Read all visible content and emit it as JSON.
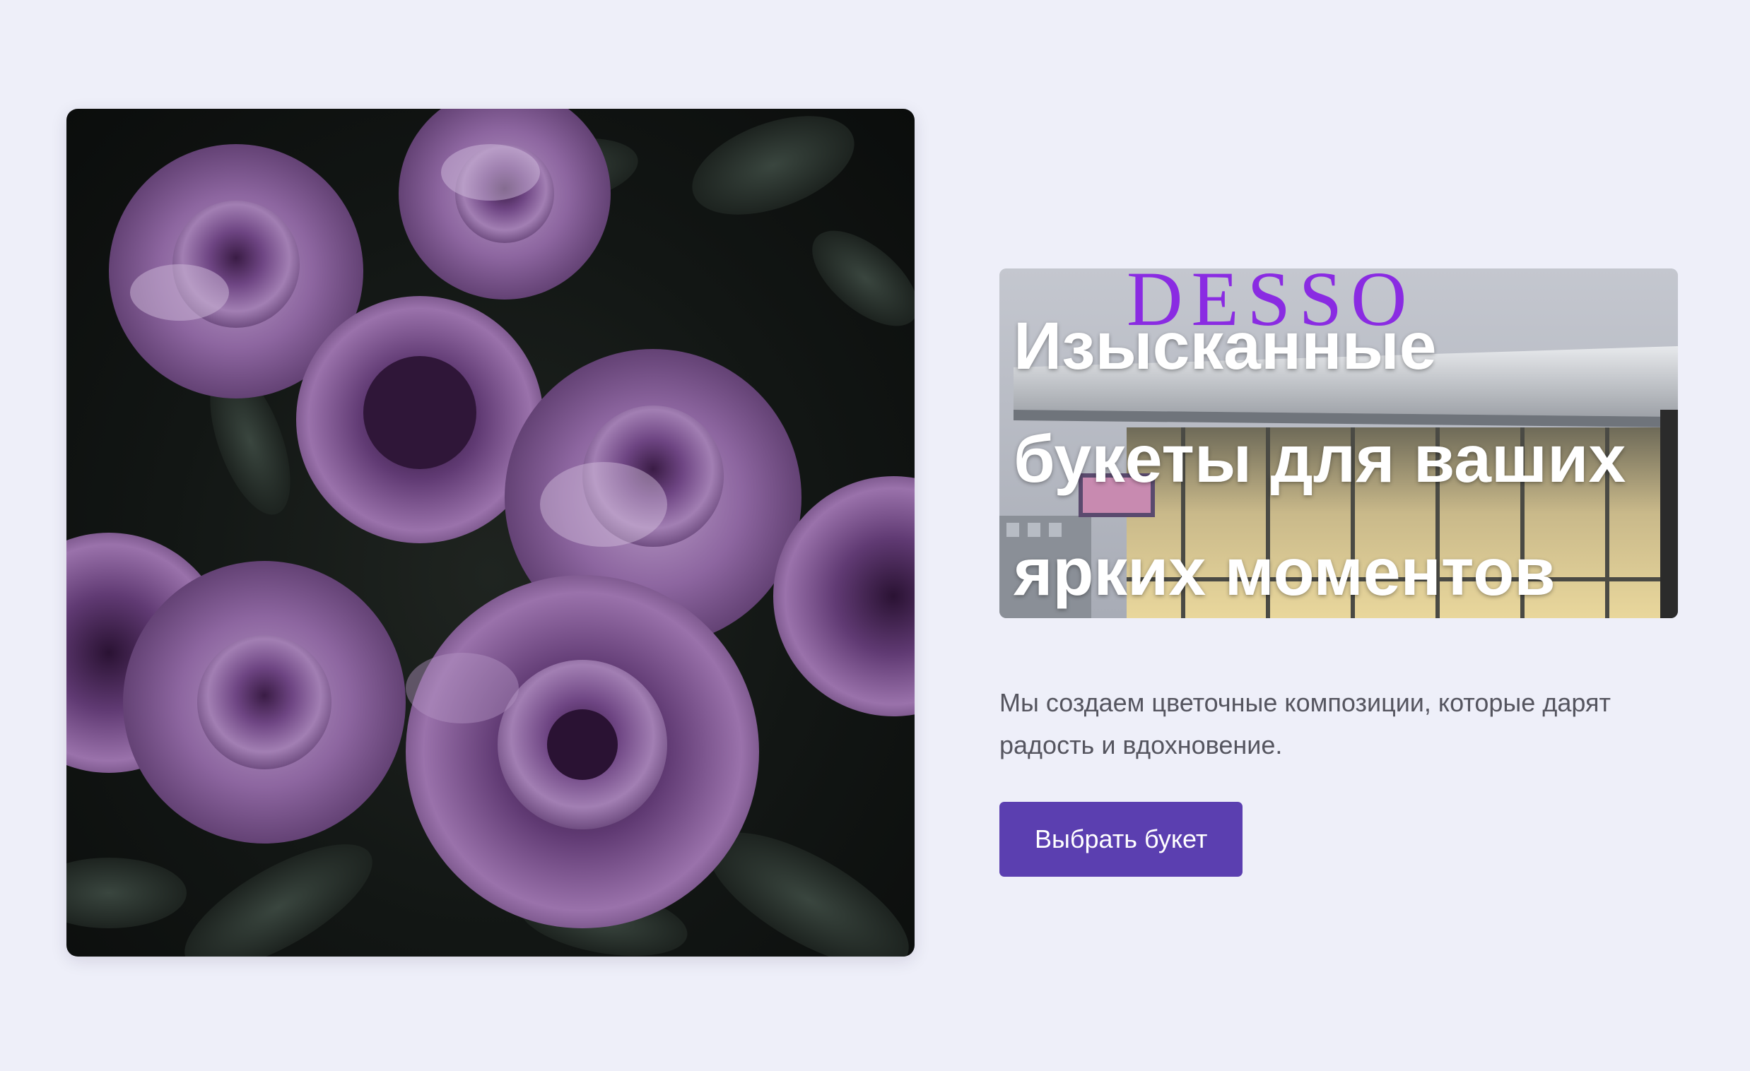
{
  "hero": {
    "title": "Изысканные букеты для ваших ярких моментов",
    "store_sign": "DESSO",
    "description": "Мы создаем цветочные композиции, которые дарят радость и вдохновение.",
    "cta_label": "Выбрать букет"
  },
  "colors": {
    "page_background": "#eeeff9",
    "accent": "#5b3fb0",
    "title_text": "#ffffff",
    "description_text": "#55555f",
    "store_sign": "#8a2be2",
    "rose": "#7a4f8f"
  },
  "images": {
    "left": "dark-purple-roses-photo",
    "title_background": "flower-shop-storefront-photo"
  }
}
